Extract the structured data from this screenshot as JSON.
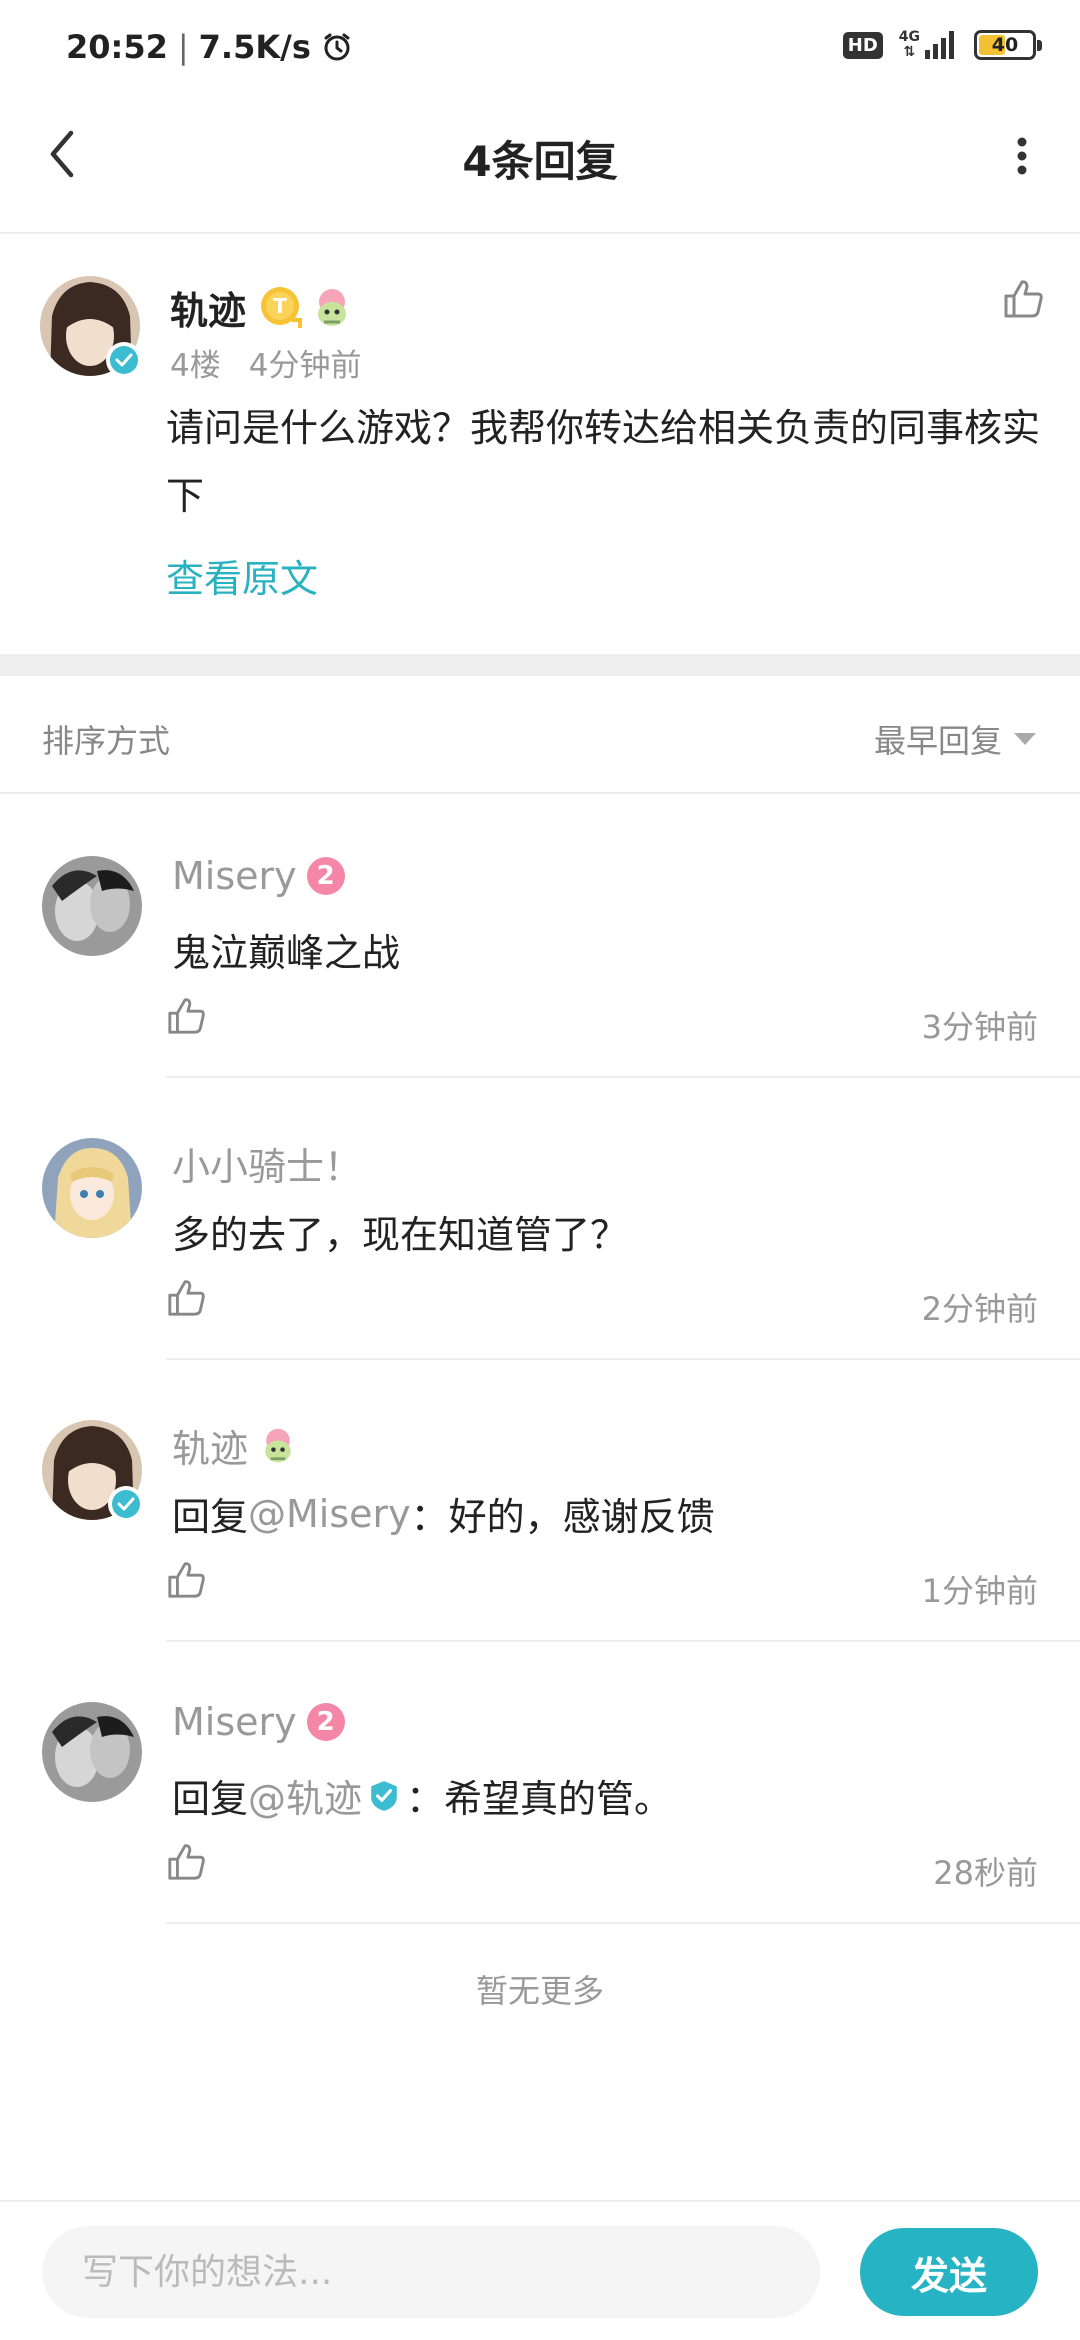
{
  "status_bar": {
    "time": "20:52",
    "net_speed": "7.5K/s",
    "hd_label": "HD",
    "network_type": "4G",
    "battery": "40"
  },
  "header": {
    "title": "4条回复"
  },
  "main_comment": {
    "author": "轨迹",
    "floor": "4楼",
    "time": "4分钟前",
    "text": "请问是什么游戏？我帮你转达给相关负责的同事核实下",
    "view_original": "查看原文",
    "badge_letter": "T"
  },
  "sort": {
    "label": "排序方式",
    "selected": "最早回复"
  },
  "replies": [
    {
      "author": "Misery",
      "level": "2",
      "text": "鬼泣巅峰之战",
      "time": "3分钟前"
    },
    {
      "author": "小小骑士！",
      "text": "多的去了，现在知道管了？",
      "time": "2分钟前"
    },
    {
      "author": "轨迹",
      "reply_prefix": "回复",
      "mention": "@Misery",
      "text": "：好的，感谢反馈",
      "time": "1分钟前"
    },
    {
      "author": "Misery",
      "level": "2",
      "reply_prefix": "回复",
      "mention": "@轨迹",
      "text": "：希望真的管。",
      "time": "28秒前"
    }
  ],
  "footer_note": "暂无更多",
  "compose": {
    "placeholder": "写下你的想法...",
    "send_label": "发送"
  },
  "colors": {
    "accent": "#26b4c4",
    "level_badge": "#f487a8",
    "battery_fill": "#f3c234"
  }
}
